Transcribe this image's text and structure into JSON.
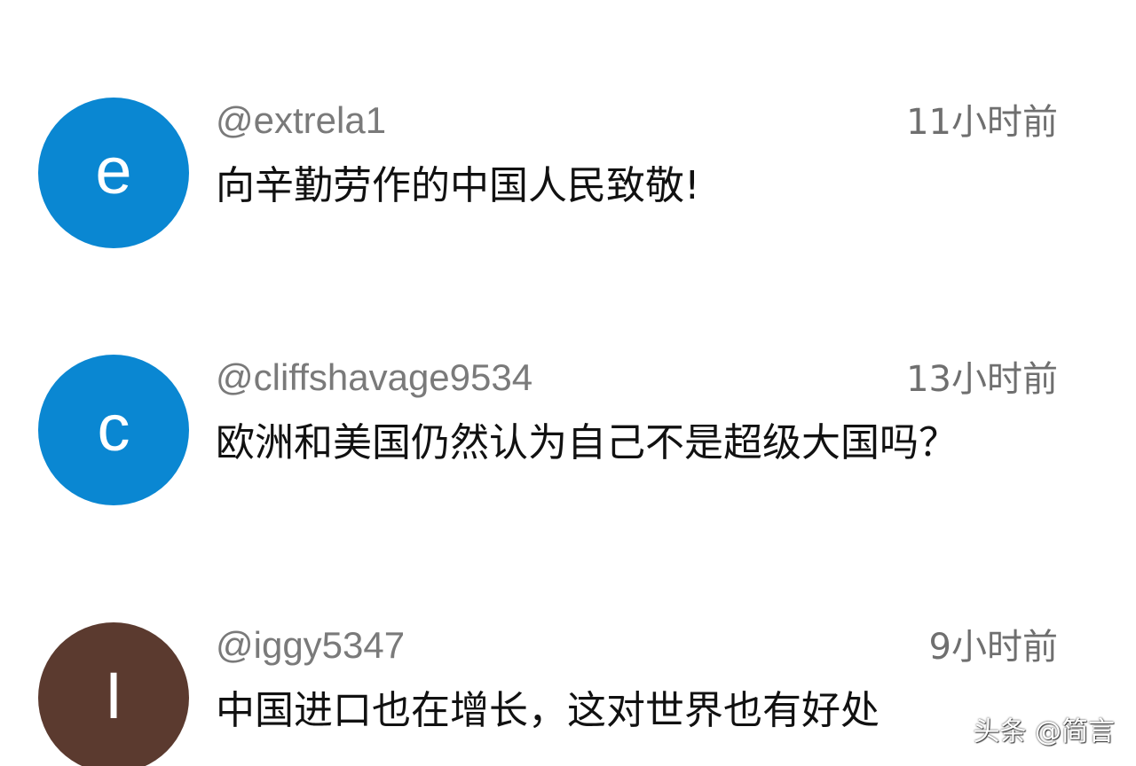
{
  "comments": [
    {
      "avatar_letter": "e",
      "avatar_color": "#0a87d2",
      "username": "@extrela1",
      "time": "11小时前",
      "text": "向辛勤劳作的中国人民致敬!"
    },
    {
      "avatar_letter": "c",
      "avatar_color": "#0a87d2",
      "username": "@cliffshavage9534",
      "time": "13小时前",
      "text": "欧洲和美国仍然认为自己不是超级大国吗？"
    },
    {
      "avatar_letter": "I",
      "avatar_color": "#5b3a2f",
      "username": "@iggy5347",
      "time": "9小时前",
      "text": "中国进口也在增长，这对世界也有好处"
    }
  ],
  "watermark": "头条 @简言"
}
